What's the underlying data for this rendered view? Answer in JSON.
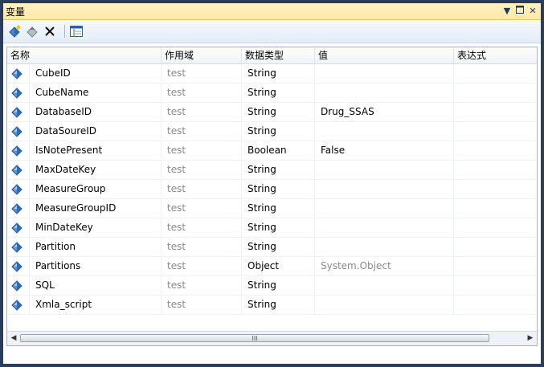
{
  "window": {
    "title": "变量"
  },
  "titlebar_buttons": [
    "dropdown-icon",
    "maximize-icon",
    "close-icon"
  ],
  "toolbar": [
    "add-variable-icon",
    "move-variable-icon",
    "delete-variable-icon",
    "grid-options-icon"
  ],
  "columns": {
    "name": "名称",
    "scope": "作用域",
    "type": "数据类型",
    "value": "值",
    "expression": "表达式"
  },
  "rows": [
    {
      "name": "CubeID",
      "scope": "test",
      "type": "String",
      "value": ""
    },
    {
      "name": "CubeName",
      "scope": "test",
      "type": "String",
      "value": ""
    },
    {
      "name": "DatabaseID",
      "scope": "test",
      "type": "String",
      "value": "Drug_SSAS"
    },
    {
      "name": "DataSoureID",
      "scope": "test",
      "type": "String",
      "value": ""
    },
    {
      "name": "IsNotePresent",
      "scope": "test",
      "type": "Boolean",
      "value": "False"
    },
    {
      "name": "MaxDateKey",
      "scope": "test",
      "type": "String",
      "value": ""
    },
    {
      "name": "MeasureGroup",
      "scope": "test",
      "type": "String",
      "value": ""
    },
    {
      "name": "MeasureGroupID",
      "scope": "test",
      "type": "String",
      "value": ""
    },
    {
      "name": "MinDateKey",
      "scope": "test",
      "type": "String",
      "value": ""
    },
    {
      "name": "Partition",
      "scope": "test",
      "type": "String",
      "value": ""
    },
    {
      "name": "Partitions",
      "scope": "test",
      "type": "Object",
      "value": "System.Object"
    },
    {
      "name": "SQL",
      "scope": "test",
      "type": "String",
      "value": ""
    },
    {
      "name": "Xmla_script",
      "scope": "test",
      "type": "String",
      "value": ""
    }
  ],
  "scrollbar": {
    "grip": "III"
  }
}
